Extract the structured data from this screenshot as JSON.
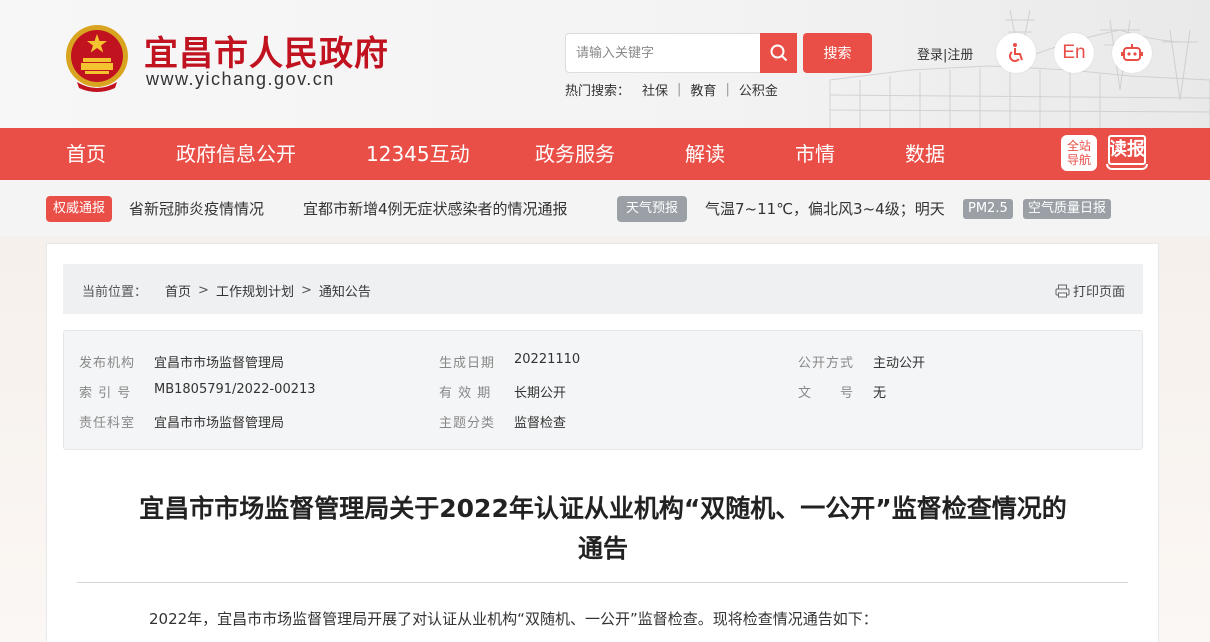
{
  "header": {
    "title": "宜昌市人民政府",
    "url": "www.yichang.gov.cn",
    "search_placeholder": "请输入关键字",
    "search_button": "搜索",
    "hot_label": "热门搜索：",
    "hot_terms": [
      "社保",
      "教育",
      "公积金"
    ],
    "login": "登录",
    "register": "注册",
    "lang_label": "En"
  },
  "nav": {
    "items": [
      "首页",
      "政府信息公开",
      "12345互动",
      "政务服务",
      "解读",
      "市情",
      "数据"
    ],
    "guide_line1": "全站",
    "guide_line2": "导航",
    "read_label": "读报"
  },
  "notice": {
    "tag": "权威通报",
    "links": [
      "省新冠肺炎疫情情况",
      "宜都市新增4例无症状感染者的情况通报"
    ],
    "weather_tag": "天气预报",
    "weather": "气温7~11℃，偏北风3~4级；明天",
    "pm_label": "PM2.5",
    "air_label": "空气质量日报"
  },
  "breadcrumb": {
    "label": "当前位置：",
    "items": [
      "首页",
      "工作规划计划",
      "通知公告"
    ],
    "print": "打印页面"
  },
  "meta": {
    "publisher_k": "发布机构",
    "publisher_v": "宜昌市市场监督管理局",
    "date_k": "生成日期",
    "date_v": "20221110",
    "mode_k": "公开方式",
    "mode_v": "主动公开",
    "index_k": "索 引 号",
    "index_v": "MB1805791/2022-00213",
    "valid_k": "有 效 期",
    "valid_v": "长期公开",
    "docno_k": "文　　号",
    "docno_v": "无",
    "dept_k": "责任科室",
    "dept_v": "宜昌市市场监督管理局",
    "topic_k": "主题分类",
    "topic_v": "监督检查"
  },
  "article": {
    "title_line1": "宜昌市市场监督管理局关于2022年认证从业机构“双随机、一公开”监督检查情况的",
    "title_line2": "通告",
    "para1": "2022年，宜昌市市场监督管理局开展了对认证从业机构“双随机、一公开”监督检查。现将检查情况通告如下："
  },
  "colors": {
    "brand_red": "#e94e47",
    "title_red": "#c1121f"
  }
}
